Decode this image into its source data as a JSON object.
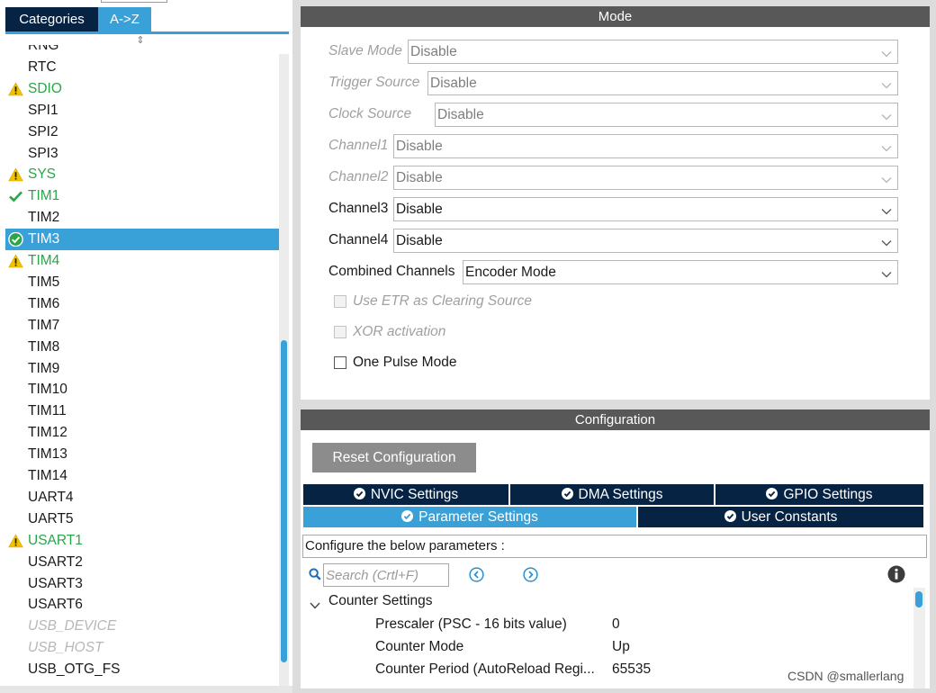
{
  "left_panel": {
    "tabs": [
      {
        "label": "Categories",
        "active": false
      },
      {
        "label": "A->Z",
        "active": true
      }
    ],
    "sort_glyph": "⇕",
    "peripherals": [
      {
        "label": "RNG",
        "status": "normal"
      },
      {
        "label": "RTC",
        "status": "normal"
      },
      {
        "label": "SDIO",
        "status": "warning"
      },
      {
        "label": "SPI1",
        "status": "normal"
      },
      {
        "label": "SPI2",
        "status": "normal"
      },
      {
        "label": "SPI3",
        "status": "normal"
      },
      {
        "label": "SYS",
        "status": "warning"
      },
      {
        "label": "TIM1",
        "status": "ok"
      },
      {
        "label": "TIM2",
        "status": "normal"
      },
      {
        "label": "TIM3",
        "status": "ok-selected"
      },
      {
        "label": "TIM4",
        "status": "warning"
      },
      {
        "label": "TIM5",
        "status": "normal"
      },
      {
        "label": "TIM6",
        "status": "normal"
      },
      {
        "label": "TIM7",
        "status": "normal"
      },
      {
        "label": "TIM8",
        "status": "normal"
      },
      {
        "label": "TIM9",
        "status": "normal"
      },
      {
        "label": "TIM10",
        "status": "normal"
      },
      {
        "label": "TIM11",
        "status": "normal"
      },
      {
        "label": "TIM12",
        "status": "normal"
      },
      {
        "label": "TIM13",
        "status": "normal"
      },
      {
        "label": "TIM14",
        "status": "normal"
      },
      {
        "label": "UART4",
        "status": "normal"
      },
      {
        "label": "UART5",
        "status": "normal"
      },
      {
        "label": "USART1",
        "status": "warning"
      },
      {
        "label": "USART2",
        "status": "normal"
      },
      {
        "label": "USART3",
        "status": "normal"
      },
      {
        "label": "USART6",
        "status": "normal"
      },
      {
        "label": "USB_DEVICE",
        "status": "disabled"
      },
      {
        "label": "USB_HOST",
        "status": "disabled"
      },
      {
        "label": "USB_OTG_FS",
        "status": "normal"
      }
    ]
  },
  "mode_panel": {
    "title": "Mode",
    "fields": [
      {
        "label": "Slave Mode",
        "value": "Disable",
        "enabled": false
      },
      {
        "label": "Trigger Source",
        "value": "Disable",
        "enabled": false
      },
      {
        "label": "Clock Source",
        "value": "Disable",
        "enabled": false
      },
      {
        "label": "Channel1",
        "value": "Disable",
        "enabled": false
      },
      {
        "label": "Channel2",
        "value": "Disable",
        "enabled": false
      },
      {
        "label": "Channel3",
        "value": "Disable",
        "enabled": true
      },
      {
        "label": "Channel4",
        "value": "Disable",
        "enabled": true
      },
      {
        "label": "Combined Channels",
        "value": "Encoder Mode",
        "enabled": true
      }
    ],
    "checkboxes": [
      {
        "label": "Use ETR as Clearing Source",
        "enabled": false,
        "checked": false
      },
      {
        "label": "XOR activation",
        "enabled": false,
        "checked": false
      },
      {
        "label": "One Pulse Mode",
        "enabled": true,
        "checked": false
      }
    ]
  },
  "config_panel": {
    "title": "Configuration",
    "reset_label": "Reset Configuration",
    "tabs_row1": [
      {
        "label": "NVIC Settings"
      },
      {
        "label": "DMA Settings"
      },
      {
        "label": "GPIO Settings"
      }
    ],
    "tabs_row2": [
      {
        "label": "Parameter Settings",
        "active": true
      },
      {
        "label": "User Constants",
        "active": false
      }
    ],
    "hint": "Configure the below parameters :",
    "search_placeholder": "Search (Crtl+F)",
    "group": "Counter Settings",
    "params": [
      {
        "name": "Prescaler (PSC - 16 bits value)",
        "value": "0"
      },
      {
        "name": "Counter Mode",
        "value": "Up"
      },
      {
        "name": "Counter Period (AutoReload Regi...",
        "value": "65535"
      }
    ]
  },
  "watermark": "CSDN @smallerlang",
  "colors": {
    "navy": "#072344",
    "accent": "#3aa0d8",
    "ok_green": "#2aa54a",
    "warn_yellow": "#f2c200",
    "header_gray": "#585858"
  },
  "icons": {
    "warning": "warning-icon",
    "ok": "check-icon",
    "ok_selected": "check-circle-icon",
    "chevron": "chevron-down-icon",
    "search": "search-icon",
    "prev": "prev-circle-icon",
    "next": "next-circle-icon",
    "info": "info-icon"
  }
}
